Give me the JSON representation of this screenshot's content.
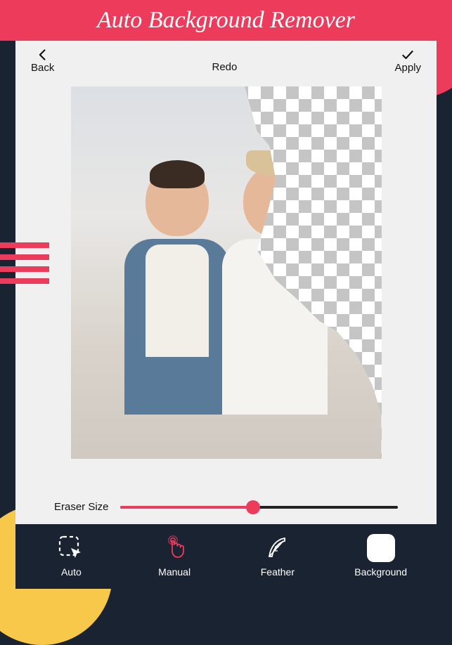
{
  "app_title": "Auto Background Remover",
  "topbar": {
    "back_label": "Back",
    "redo_label": "Redo",
    "apply_label": "Apply"
  },
  "slider": {
    "label": "Eraser Size",
    "value": 48,
    "min": 0,
    "max": 100
  },
  "toolbar": {
    "auto": "Auto",
    "manual": "Manual",
    "feather": "Feather",
    "background": "Background"
  },
  "colors": {
    "accent": "#ed3b5b",
    "dark": "#1a2332",
    "yellow": "#f7c84a"
  }
}
